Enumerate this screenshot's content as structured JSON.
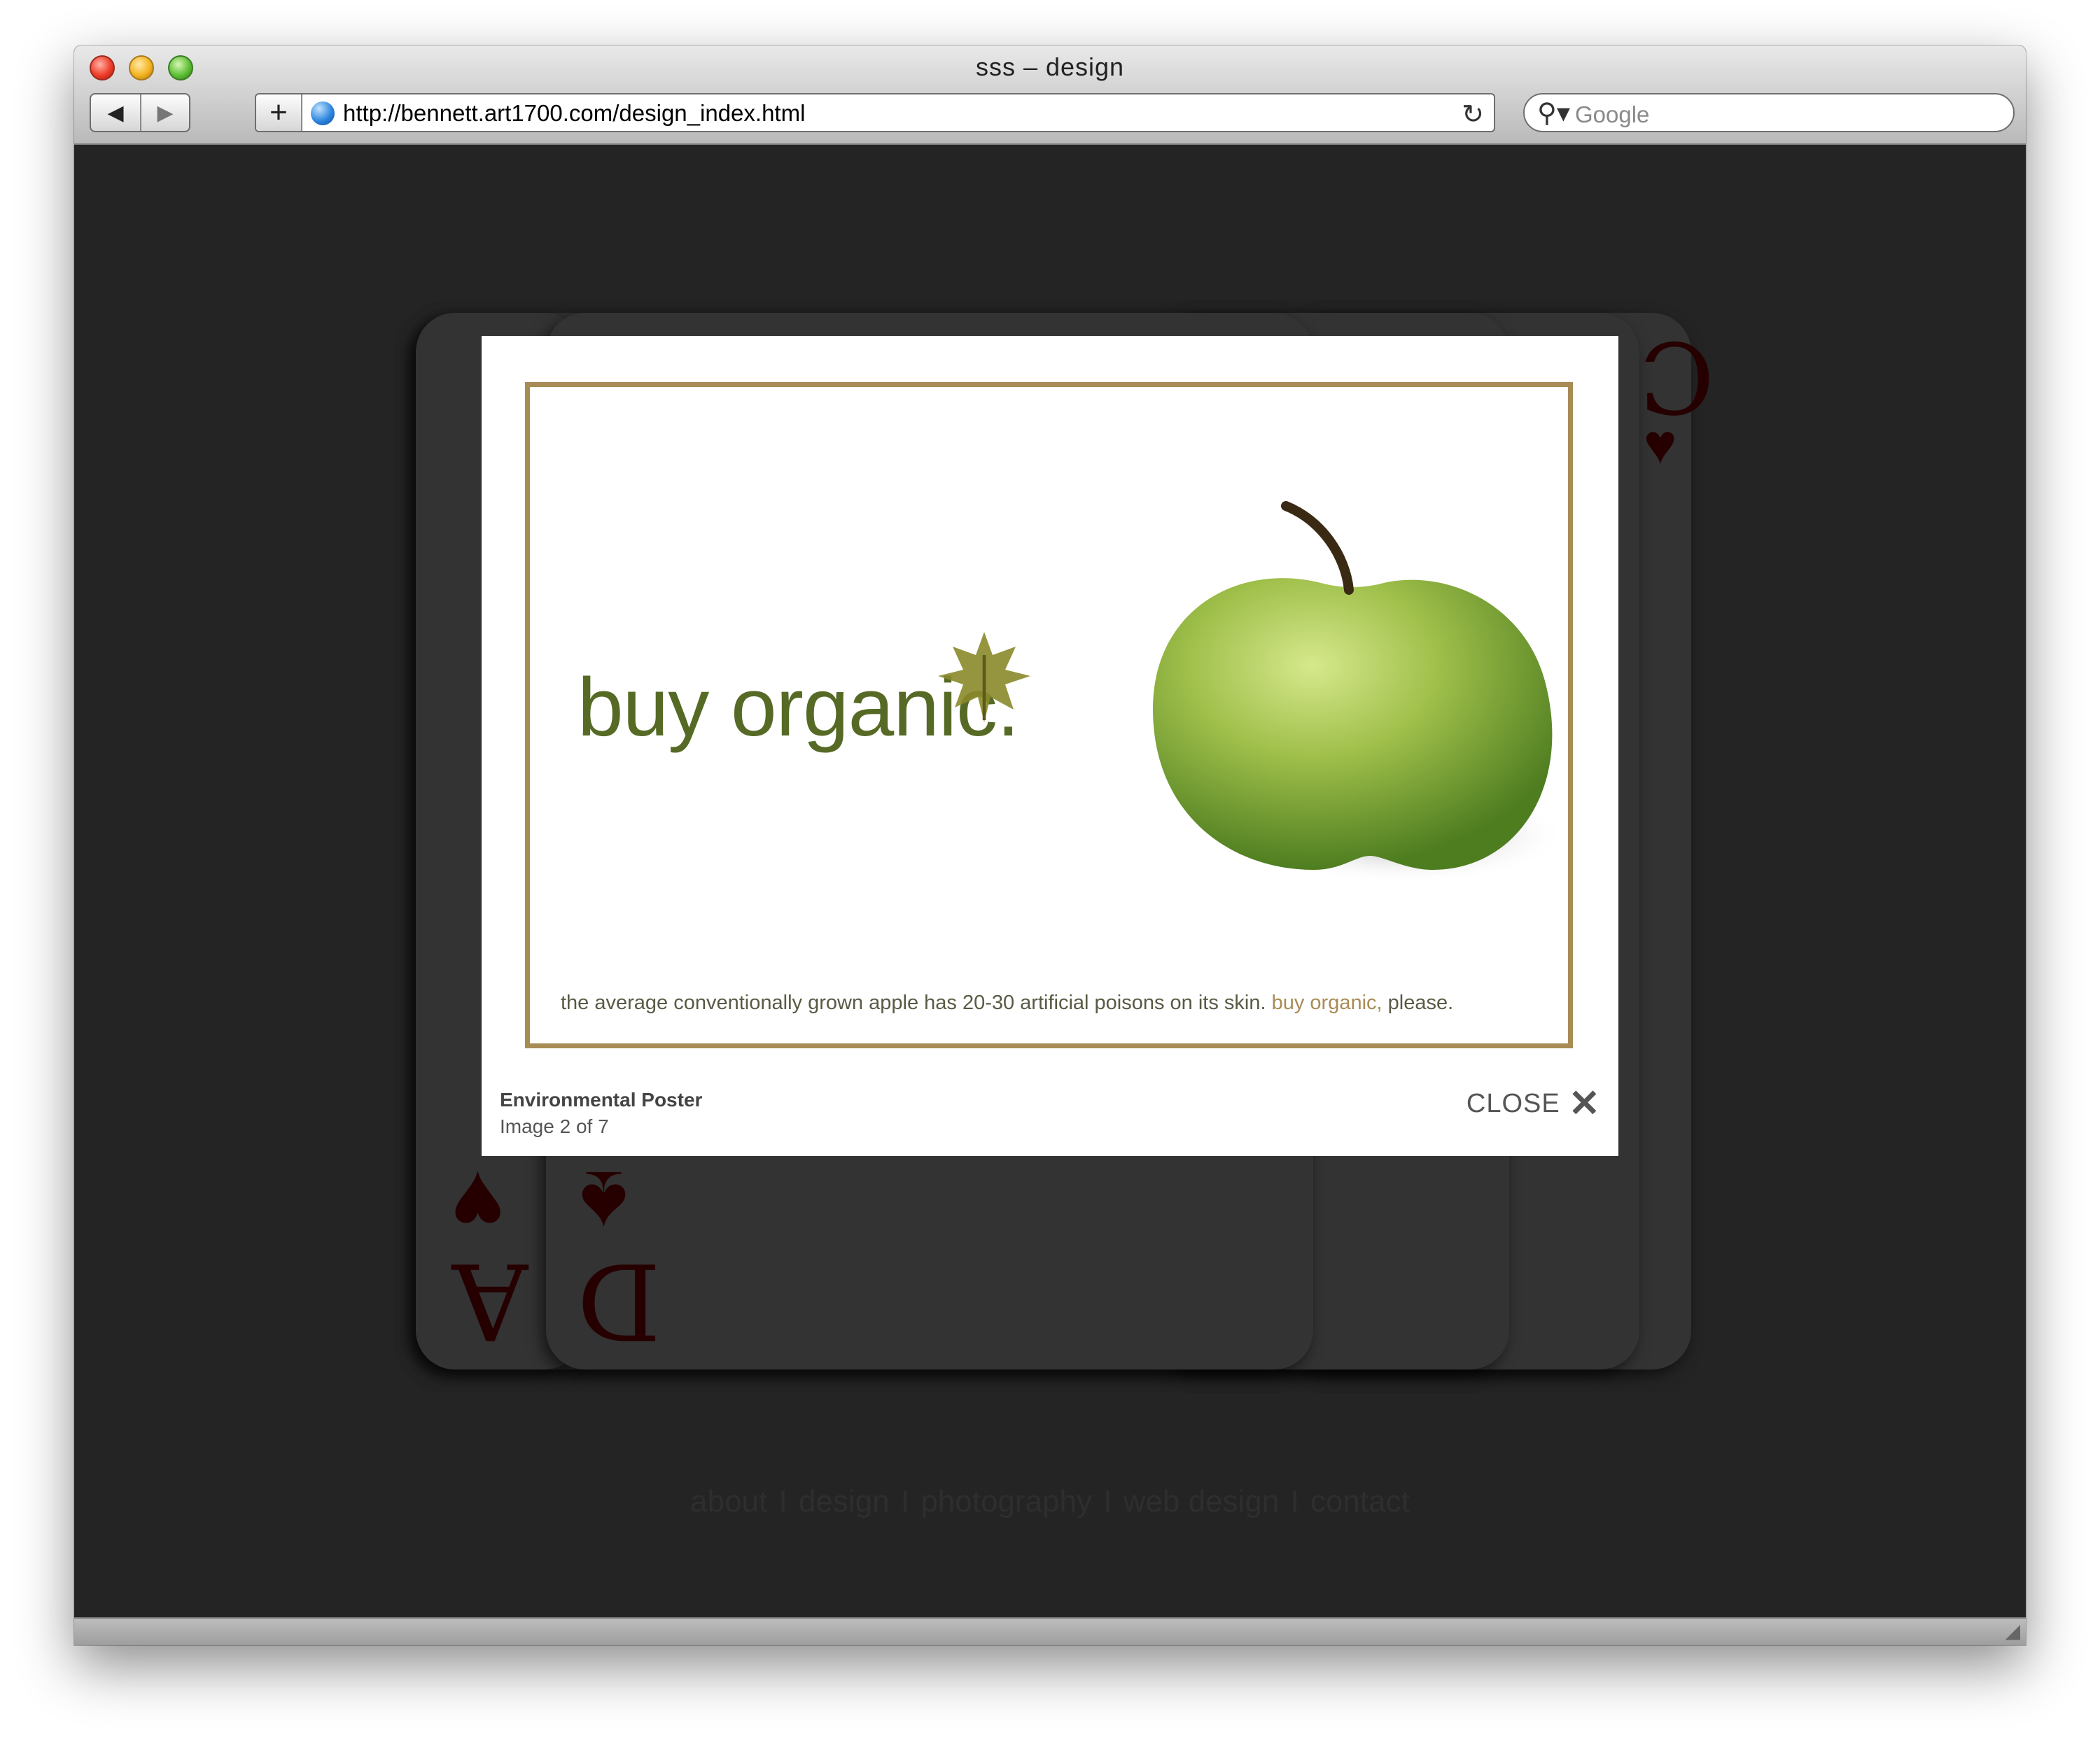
{
  "window": {
    "title": "sss – design",
    "back_icon": "◀",
    "forward_icon": "▶",
    "add_icon": "+",
    "url": "http://bennett.art1700.com/design_index.html",
    "reload_icon": "↻",
    "search_icon": "⚲▾",
    "search_placeholder": "Google"
  },
  "cards": [
    {
      "rank": "A",
      "suit": "♥"
    },
    {
      "rank": "D",
      "suit": "♠"
    },
    {
      "rank": "C",
      "suit": "♥"
    }
  ],
  "lightbox": {
    "poster": {
      "headline": "buy organic.",
      "tagline_main": "the average conventionally grown apple has 20-30 artificial poisons on its skin.",
      "tagline_accent": "buy organic,",
      "tagline_end": "please."
    },
    "caption_title": "Environmental Poster",
    "caption_count": "Image 2 of 7",
    "close_label": "CLOSE",
    "close_icon": "✕"
  },
  "footer": {
    "links": [
      "about",
      "design",
      "photography",
      "web design",
      "contact"
    ],
    "separator": "I"
  },
  "colors": {
    "page_bg": "#242424",
    "card": "#333333",
    "poster_border": "#a88c56",
    "headline": "#566a25"
  }
}
